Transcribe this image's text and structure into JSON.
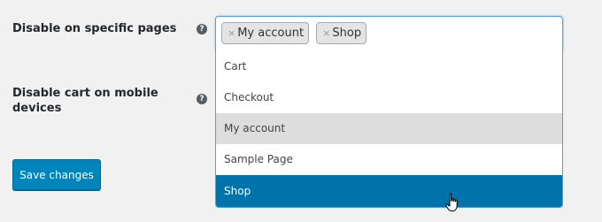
{
  "settings": {
    "disable_pages_label": "Disable on specific pages",
    "disable_mobile_label": "Disable cart on mobile devices",
    "help_glyph": "?",
    "save_label": "Save changes"
  },
  "select": {
    "remove_glyph": "×",
    "chips": [
      "My account",
      "Shop"
    ],
    "options": [
      {
        "label": "Cart",
        "state": "normal"
      },
      {
        "label": "Checkout",
        "state": "normal"
      },
      {
        "label": "My account",
        "state": "selected"
      },
      {
        "label": "Sample Page",
        "state": "normal"
      },
      {
        "label": "Shop",
        "state": "highlighted"
      }
    ]
  },
  "colors": {
    "accent": "#0073aa",
    "button": "#0085ba",
    "selected_option": "#dddddd"
  },
  "icons": {
    "help": "question-circle-icon",
    "cursor": "hand-pointer-icon"
  }
}
